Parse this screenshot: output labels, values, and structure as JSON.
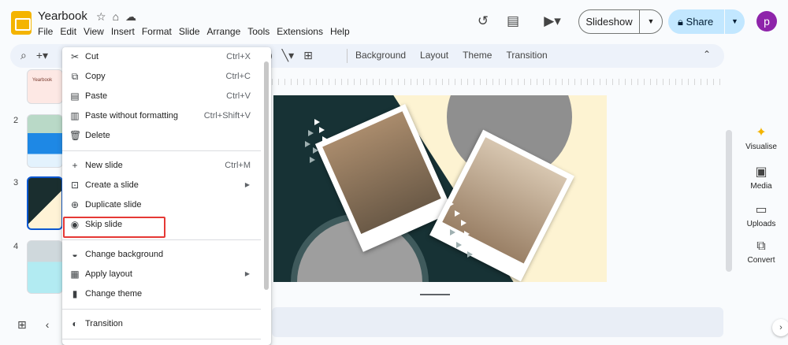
{
  "header": {
    "title": "Yearbook",
    "star_icon": "star-icon",
    "folder_icon": "move-folder-icon",
    "cloud_icon": "cloud-status-icon",
    "menu": [
      "File",
      "Edit",
      "View",
      "Insert",
      "Format",
      "Slide",
      "Arrange",
      "Tools",
      "Extensions",
      "Help"
    ],
    "slideshow_label": "Slideshow",
    "share_label": "Share",
    "avatar_letter": "p"
  },
  "toolbar": {
    "items": [
      "Background",
      "Layout",
      "Theme",
      "Transition"
    ]
  },
  "filmstrip": {
    "slides": [
      {
        "number": "",
        "label": "Yearbook"
      },
      {
        "number": "2",
        "label": ""
      },
      {
        "number": "3",
        "label": ""
      },
      {
        "number": "4",
        "label": ""
      }
    ]
  },
  "side_panel": {
    "items": [
      {
        "label": "Visualise",
        "icon": "sparkle-icon"
      },
      {
        "label": "Media",
        "icon": "media-icon"
      },
      {
        "label": "Uploads",
        "icon": "folder-icon"
      },
      {
        "label": "Convert",
        "icon": "convert-icon"
      }
    ]
  },
  "context_menu": {
    "items": [
      {
        "label": "Cut",
        "shortcut": "Ctrl+X",
        "icon": "scissors-icon"
      },
      {
        "label": "Copy",
        "shortcut": "Ctrl+C",
        "icon": "copy-icon"
      },
      {
        "label": "Paste",
        "shortcut": "Ctrl+V",
        "icon": "paste-icon"
      },
      {
        "label": "Paste without formatting",
        "shortcut": "Ctrl+Shift+V",
        "icon": "paste-plain-icon"
      },
      {
        "label": "Delete",
        "shortcut": "",
        "icon": "trash-icon"
      },
      {
        "label": "New slide",
        "shortcut": "Ctrl+M",
        "icon": "plus-icon"
      },
      {
        "label": "Create a slide",
        "shortcut": "",
        "icon": "add-slide-icon",
        "submenu": true
      },
      {
        "label": "Duplicate slide",
        "shortcut": "",
        "icon": "duplicate-icon"
      },
      {
        "label": "Skip slide",
        "shortcut": "",
        "icon": "eye-icon"
      },
      {
        "label": "Change background",
        "shortcut": "",
        "icon": "paint-drop-icon"
      },
      {
        "label": "Apply layout",
        "shortcut": "",
        "icon": "layout-icon",
        "submenu": true
      },
      {
        "label": "Change theme",
        "shortcut": "",
        "icon": "paint-roller-icon"
      },
      {
        "label": "Transition",
        "shortcut": "",
        "icon": "transition-icon"
      }
    ],
    "highlighted": "Skip slide"
  },
  "colors": {
    "accent": "#0b57d0",
    "share_bg": "#c2e7ff",
    "highlight_border": "#e53935",
    "slide_dark": "#173235",
    "slide_cream": "#fdf3d2"
  }
}
